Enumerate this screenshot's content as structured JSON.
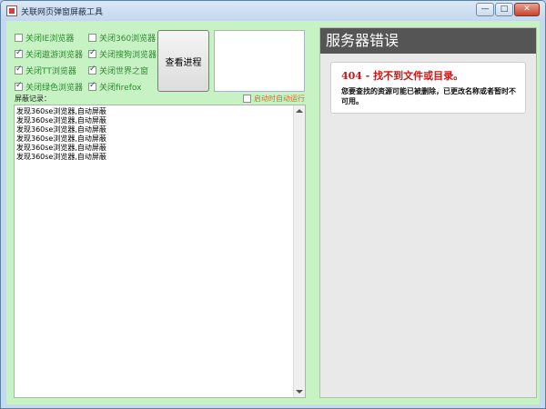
{
  "window": {
    "title": "关联网页弹窗屏蔽工具"
  },
  "titlebar_buttons": {
    "minimize": "—",
    "maximize": "□",
    "close": "✕"
  },
  "options": [
    {
      "label": "关闭IE浏览器",
      "checked": false
    },
    {
      "label": "关闭360浏览器",
      "checked": false
    },
    {
      "label": "关闭遨游浏览器",
      "checked": true
    },
    {
      "label": "关闭搜狗浏览器",
      "checked": true
    },
    {
      "label": "关闭TT浏览器",
      "checked": true
    },
    {
      "label": "关闭世界之窗",
      "checked": true
    },
    {
      "label": "关闭绿色浏览器",
      "checked": true
    },
    {
      "label": "关闭firefox",
      "checked": true
    }
  ],
  "actions": {
    "view_process": "查看进程"
  },
  "log": {
    "label": "屏蔽记录：",
    "autostart_label": "启动时自动运行",
    "autostart_checked": false,
    "lines": [
      "发现360se浏览器,自动屏蔽",
      "发现360se浏览器,自动屏蔽",
      "发现360se浏览器,自动屏蔽",
      "发现360se浏览器,自动屏蔽",
      "发现360se浏览器,自动屏蔽",
      "发现360se浏览器,自动屏蔽"
    ]
  },
  "web": {
    "header": "服务器错误",
    "error_title": "404 - 找不到文件或目录。",
    "error_body": "您要查找的资源可能已被删除，已更改名称或者暂时不可用。"
  },
  "colors": {
    "panel_bg": "#c6f2c4",
    "option_text": "#2f8a2f",
    "autostart_text": "#e06a2a",
    "error_red": "#c81717",
    "header_bg": "#555555"
  },
  "icons": {
    "app": "app-icon",
    "scroll_up": "scroll-up-arrow-icon",
    "scroll_down": "scroll-down-arrow-icon"
  }
}
